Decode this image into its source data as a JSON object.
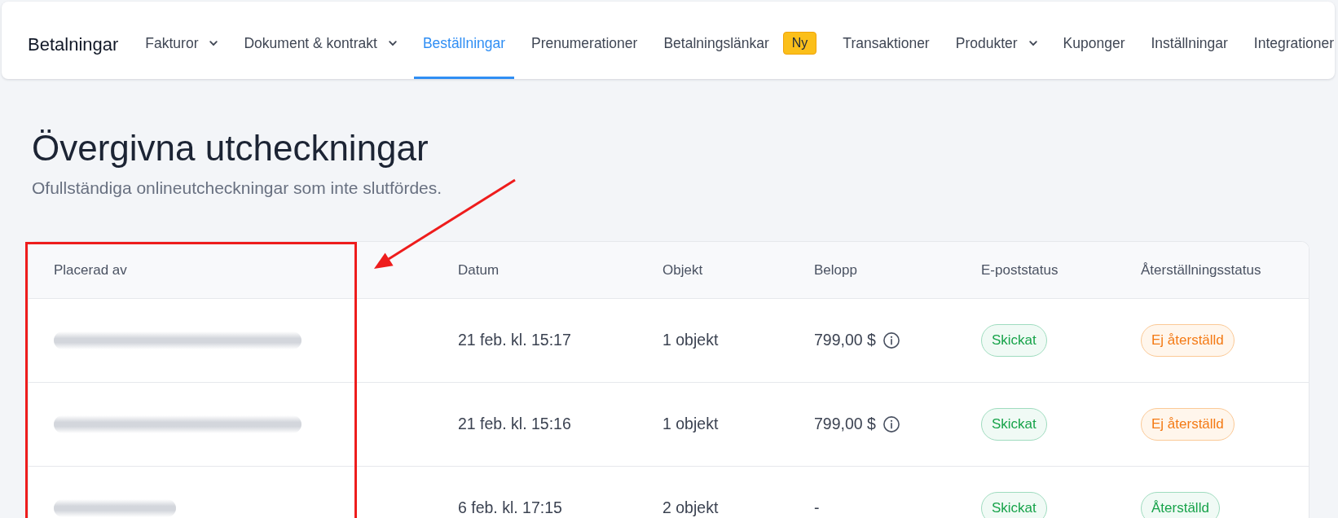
{
  "nav": {
    "brand": "Betalningar",
    "items": [
      {
        "label": "Fakturor",
        "selected": false,
        "dropdown": true
      },
      {
        "label": "Dokument & kontrakt",
        "selected": false,
        "dropdown": true
      },
      {
        "label": "Beställningar",
        "selected": true,
        "dropdown": false
      },
      {
        "label": "Prenumerationer",
        "selected": false,
        "dropdown": false
      },
      {
        "label": "Betalningslänkar",
        "selected": false,
        "dropdown": false,
        "badge": "Ny"
      },
      {
        "label": "Transaktioner",
        "selected": false,
        "dropdown": false
      },
      {
        "label": "Produkter",
        "selected": false,
        "dropdown": true
      },
      {
        "label": "Kuponger",
        "selected": false,
        "dropdown": false
      },
      {
        "label": "Inställningar",
        "selected": false,
        "dropdown": false
      },
      {
        "label": "Integrationer",
        "selected": false,
        "dropdown": false
      }
    ]
  },
  "page": {
    "title": "Övergivna utcheckningar",
    "subtitle": "Ofullständiga onlineutcheckningar som inte slutfördes."
  },
  "table": {
    "columns": [
      "Placerad av",
      "Datum",
      "Objekt",
      "Belopp",
      "E-poststatus",
      "Återställningsstatus"
    ],
    "rows": [
      {
        "placed_by": {
          "kind": "long"
        },
        "date": "21 feb. kl. 15:17",
        "items": "1 objekt",
        "amount": "799,00 $",
        "amount_info": true,
        "email_status": {
          "label": "Skickat",
          "kind": "success"
        },
        "recovery_status": {
          "label": "Ej återställd",
          "kind": "warning"
        }
      },
      {
        "placed_by": {
          "kind": "long"
        },
        "date": "21 feb. kl. 15:16",
        "items": "1 objekt",
        "amount": "799,00 $",
        "amount_info": true,
        "email_status": {
          "label": "Skickat",
          "kind": "success"
        },
        "recovery_status": {
          "label": "Ej återställd",
          "kind": "warning"
        }
      },
      {
        "placed_by": {
          "kind": "short"
        },
        "date": "6 feb. kl. 17:15",
        "items": "2 objekt",
        "amount": "-",
        "amount_info": false,
        "email_status": {
          "label": "Skickat",
          "kind": "success"
        },
        "recovery_status": {
          "label": "Återställd",
          "kind": "success"
        }
      }
    ]
  },
  "annotations": {
    "highlight_box": true,
    "arrow": true
  }
}
